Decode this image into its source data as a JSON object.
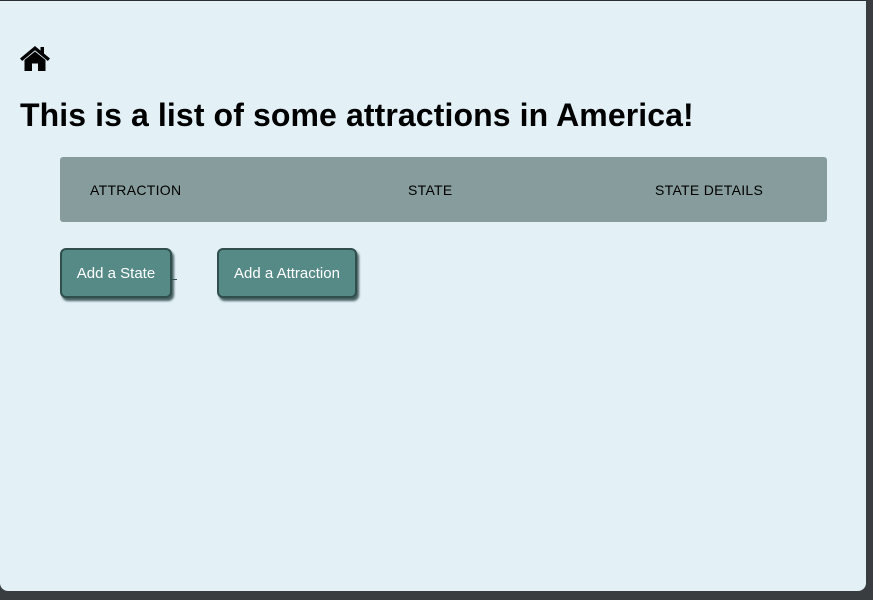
{
  "home": {
    "icon": "home-icon"
  },
  "page": {
    "title": "This is a list of some attractions in America!"
  },
  "table": {
    "columns": [
      "ATTRACTION",
      "STATE",
      "STATE DETAILS"
    ],
    "rows": []
  },
  "actions": {
    "add_state_label": "Add a State",
    "add_attraction_label": "Add a Attraction"
  },
  "colors": {
    "background": "#e3f1f7",
    "table_header": "#879c9c",
    "button": "#568a86",
    "button_border": "#2f4e4c"
  }
}
